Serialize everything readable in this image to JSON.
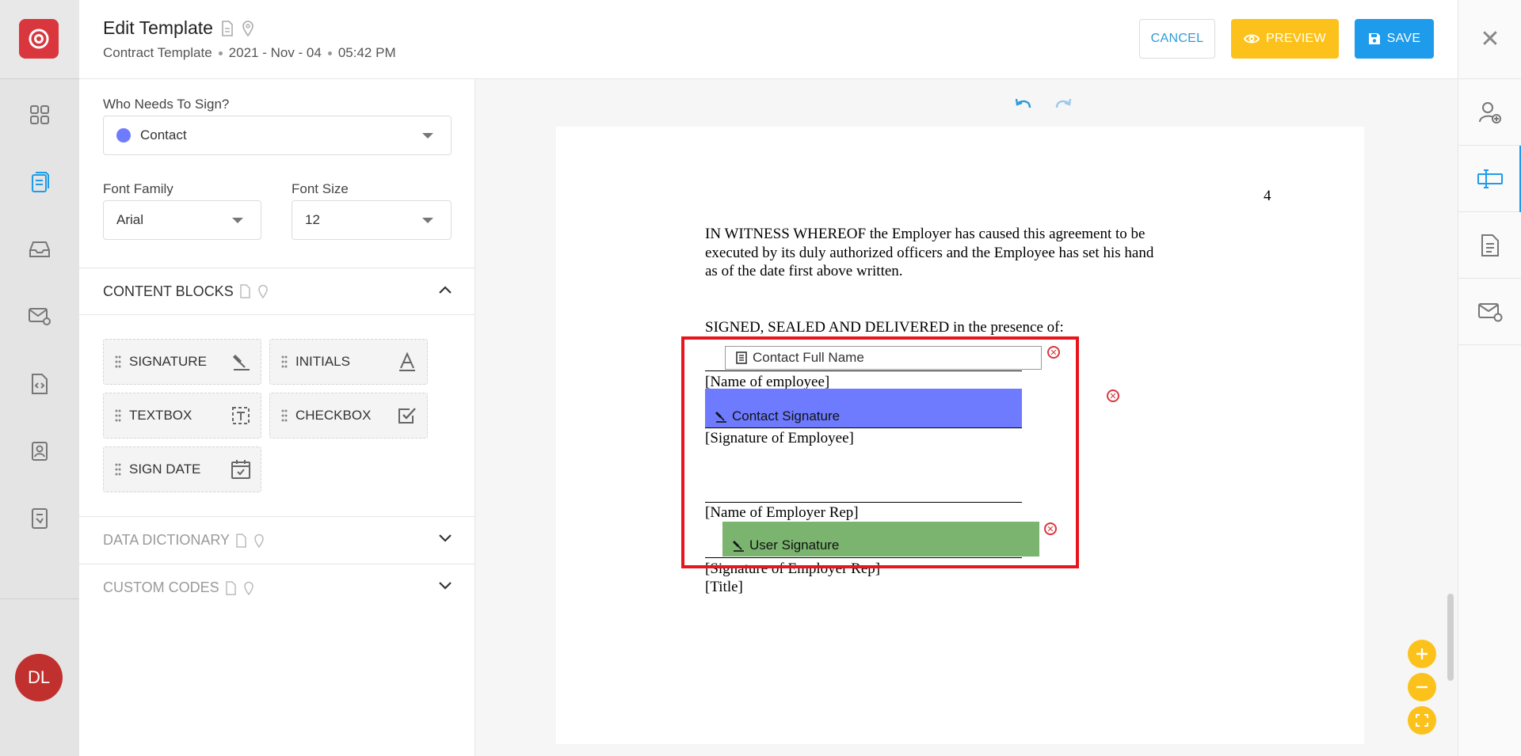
{
  "header": {
    "title": "Edit Template",
    "template_name": "Contract Template",
    "date": "2021 - Nov - 04",
    "time": "05:42 PM",
    "cancel_label": "CANCEL",
    "preview_label": "PREVIEW",
    "save_label": "SAVE"
  },
  "nav": {
    "avatar_initials": "DL",
    "items": [
      "dashboard-icon",
      "documents-icon",
      "inbox-icon",
      "email-settings-icon",
      "code-icon",
      "contacts-icon",
      "file-settings-icon"
    ]
  },
  "panel": {
    "who_label": "Who Needs To Sign?",
    "who_value": "Contact",
    "font_family_label": "Font Family",
    "font_family_value": "Arial",
    "font_size_label": "Font Size",
    "font_size_value": "12",
    "content_blocks_title": "CONTENT BLOCKS",
    "blocks": [
      "SIGNATURE",
      "INITIALS",
      "TEXTBOX",
      "CHECKBOX",
      "SIGN DATE"
    ],
    "data_dictionary_title": "DATA DICTIONARY",
    "custom_codes_title": "CUSTOM CODES"
  },
  "document": {
    "page_number": "4",
    "paragraph_1": "IN WITNESS WHEREOF the Employer has caused this agreement to be",
    "paragraph_2": "executed by its duly authorized officers and the Employee has set his hand",
    "paragraph_3": "as of the date first above written.",
    "signed_line": "SIGNED, SEALED AND DELIVERED in the presence of:",
    "name_of_employee": "[Name of employee]",
    "signature_of_employee": "[Signature of Employee]",
    "name_of_employer_rep": "[Name of Employer Rep]",
    "signature_of_employer_rep": "[Signature of Employer Rep]",
    "title": "[Title]",
    "field_contact_full_name": "Contact Full Name",
    "field_contact_signature": "Contact Signature",
    "field_user_signature": "User Signature"
  },
  "colors": {
    "brand": "#d9363e",
    "primary": "#1e9bea",
    "warning": "#fcc21b",
    "contact_signature": "#6e7bff",
    "user_signature": "#7ab46f",
    "highlight": "#e8161c"
  }
}
